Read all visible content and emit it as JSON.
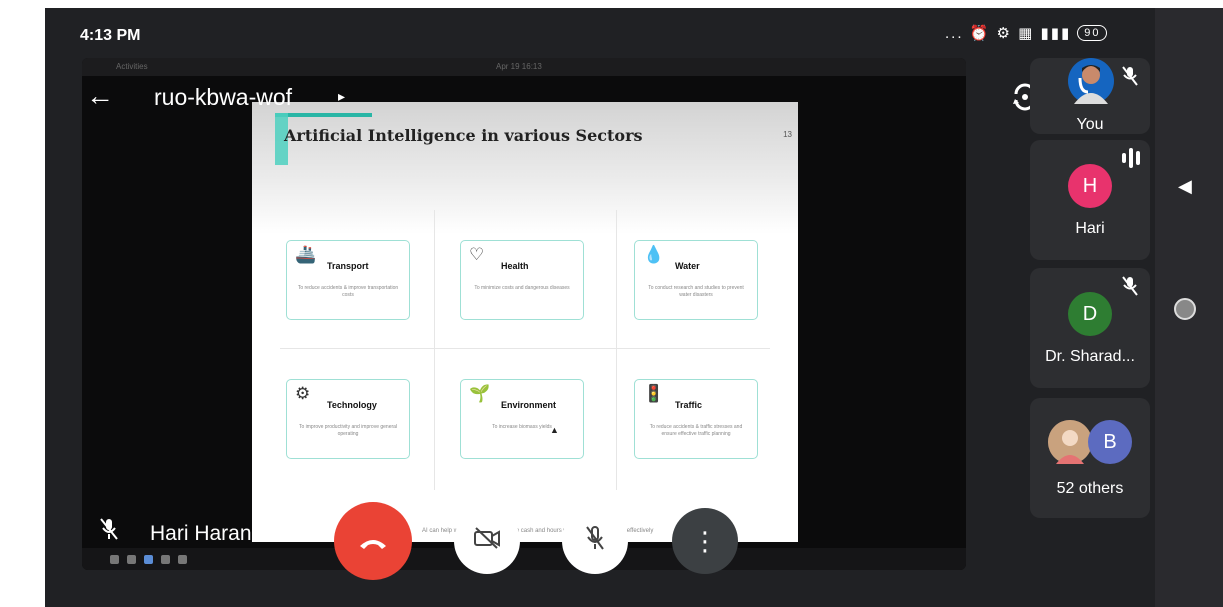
{
  "status_bar": {
    "time": "4:13 PM",
    "icons": "... ⏰ ⚙ ▦ ▮▮▮",
    "battery": "90"
  },
  "meeting": {
    "back_icon": "arrow-left-icon",
    "code": "ruo-kbwa-wof",
    "chevron": "▸"
  },
  "shared_screen": {
    "topbar_left": "Activities",
    "topbar_mid": "Apr 19 16:13",
    "slide": {
      "title": "Artificial Intelligence in various Sectors",
      "page_number": "13",
      "cards": [
        {
          "title": "Transport",
          "icon": "🚢",
          "desc": "To reduce accidents & improve transportation costs"
        },
        {
          "title": "Health",
          "icon": "♡",
          "desc": "To minimize costs and dangerous diseases"
        },
        {
          "title": "Water",
          "icon": "💧",
          "desc": "To conduct research and studies to prevent water disasters"
        },
        {
          "title": "Technology",
          "icon": "⚙",
          "desc": "To improve productivity and improve general operating"
        },
        {
          "title": "Environment",
          "icon": "🌱",
          "desc": "To increase biomass yields"
        },
        {
          "title": "Traffic",
          "icon": "🚦",
          "desc": "To reduce accidents & traffic stresses and ensure effective traffic planning"
        }
      ],
      "footer": "AI can help with 100% safety of both cash and hours which reflects business effectively"
    }
  },
  "presenter": {
    "name": "Hari Haran",
    "mic_icon": "mic-off-icon"
  },
  "controls": {
    "end_call": "✆",
    "camera": "⊠",
    "mic": "🎙",
    "more": "⋮"
  },
  "participants": [
    {
      "label": "You",
      "kind": "photo",
      "muted": true
    },
    {
      "label": "Hari",
      "initial": "H",
      "color": "#e8336d",
      "speaking": true
    },
    {
      "label": "Dr. Sharad...",
      "initial": "D",
      "color": "#2e7d32",
      "muted": true
    },
    {
      "label": "52 others",
      "initial": "B",
      "color": "#5c6bc0"
    }
  ],
  "icons": {
    "muted": "🎙̸",
    "switch_camera": "⟳"
  }
}
